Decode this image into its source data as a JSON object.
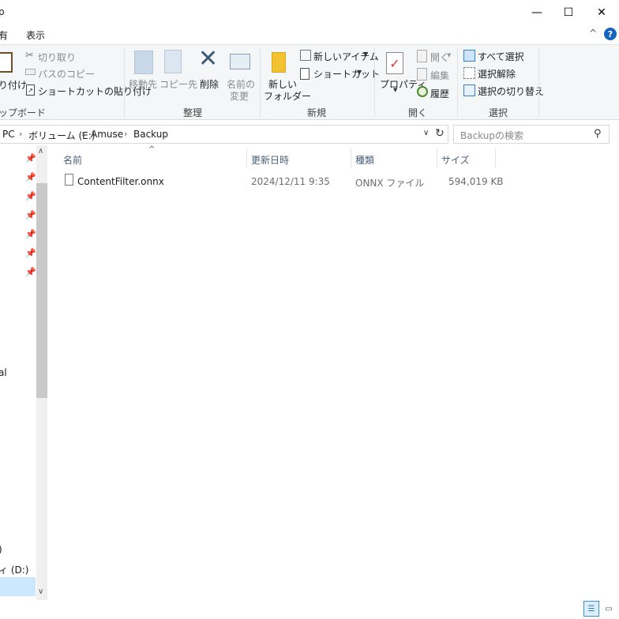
{
  "window": {
    "title": "p",
    "minimize_glyph": "—",
    "maximize_glyph": "☐",
    "close_glyph": "✕"
  },
  "menu": {
    "tabs": [
      "有",
      "表示"
    ],
    "collapse_glyph": "^",
    "help_glyph": "?"
  },
  "ribbon": {
    "clipboard": {
      "paste_label": "り付け",
      "cut_label": "切り取り",
      "copy_path_label": "パスのコピー",
      "paste_shortcut_label": "ショートカットの貼り付け",
      "group_label": "ップボード"
    },
    "organize": {
      "move_label": "移動先",
      "copy_to_label": "コピー先",
      "delete_label": "削除",
      "rename_label_1": "名前の",
      "rename_label_2": "変更",
      "group_label": "整理"
    },
    "new": {
      "new_folder_label_1": "新しい",
      "new_folder_label_2": "フォルダー",
      "new_item_label": "新しいアイテム",
      "shortcut_label": "ショートカット",
      "group_label": "新規"
    },
    "open": {
      "properties_label": "プロパティ",
      "open_label": "開く",
      "edit_label": "編集",
      "history_label": "履歴",
      "group_label": "開く"
    },
    "select": {
      "select_all_label": "すべて選択",
      "select_none_label": "選択解除",
      "invert_label": "選択の切り替え",
      "group_label": "選択"
    }
  },
  "address": {
    "crumbs": [
      "PC",
      "ボリューム (E:)",
      "Amuse",
      "Backup"
    ],
    "separator": "›",
    "dropdown_glyph": "∨",
    "refresh_glyph": "↻"
  },
  "search": {
    "placeholder": "Backupの検索",
    "icon_glyph": "⚲"
  },
  "nav": {
    "pin_glyph": "📌",
    "items": [
      "al",
      ")",
      "ィ (D:)"
    ]
  },
  "columns": {
    "name": "名前",
    "modified": "更新日時",
    "type": "種類",
    "size": "サイズ",
    "sort_glyph": "^"
  },
  "files": [
    {
      "name": "ContentFilter.onnx",
      "modified": "2024/12/11 9:35",
      "type": "ONNX ファイル",
      "size": "594,019 KB"
    }
  ]
}
